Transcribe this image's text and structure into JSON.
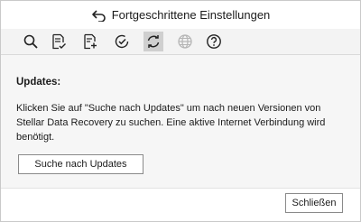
{
  "window": {
    "title": "Fortgeschrittene Einstellungen"
  },
  "toolbar": {
    "items": [
      {
        "icon": "search-icon"
      },
      {
        "icon": "document-check-icon"
      },
      {
        "icon": "document-add-icon"
      },
      {
        "icon": "check-circle-icon"
      },
      {
        "icon": "refresh-icon",
        "active": true
      },
      {
        "icon": "globe-icon",
        "disabled": true
      },
      {
        "icon": "help-icon"
      }
    ]
  },
  "updates": {
    "heading": "Updates:",
    "description": "Klicken Sie auf \"Suche nach Updates\" um nach neuen Versionen von Stellar Data Recovery zu suchen. Eine aktive Internet Verbindung wird benötigt.",
    "button_label": "Suche nach Updates"
  },
  "footer": {
    "close_label": "Schließen"
  },
  "colors": {
    "toolbar_bg": "#f3f3f3",
    "content_bg": "#f6f6f6",
    "active_icon_bg": "#cfcfcf",
    "disabled_icon": "#b5b5b5"
  }
}
